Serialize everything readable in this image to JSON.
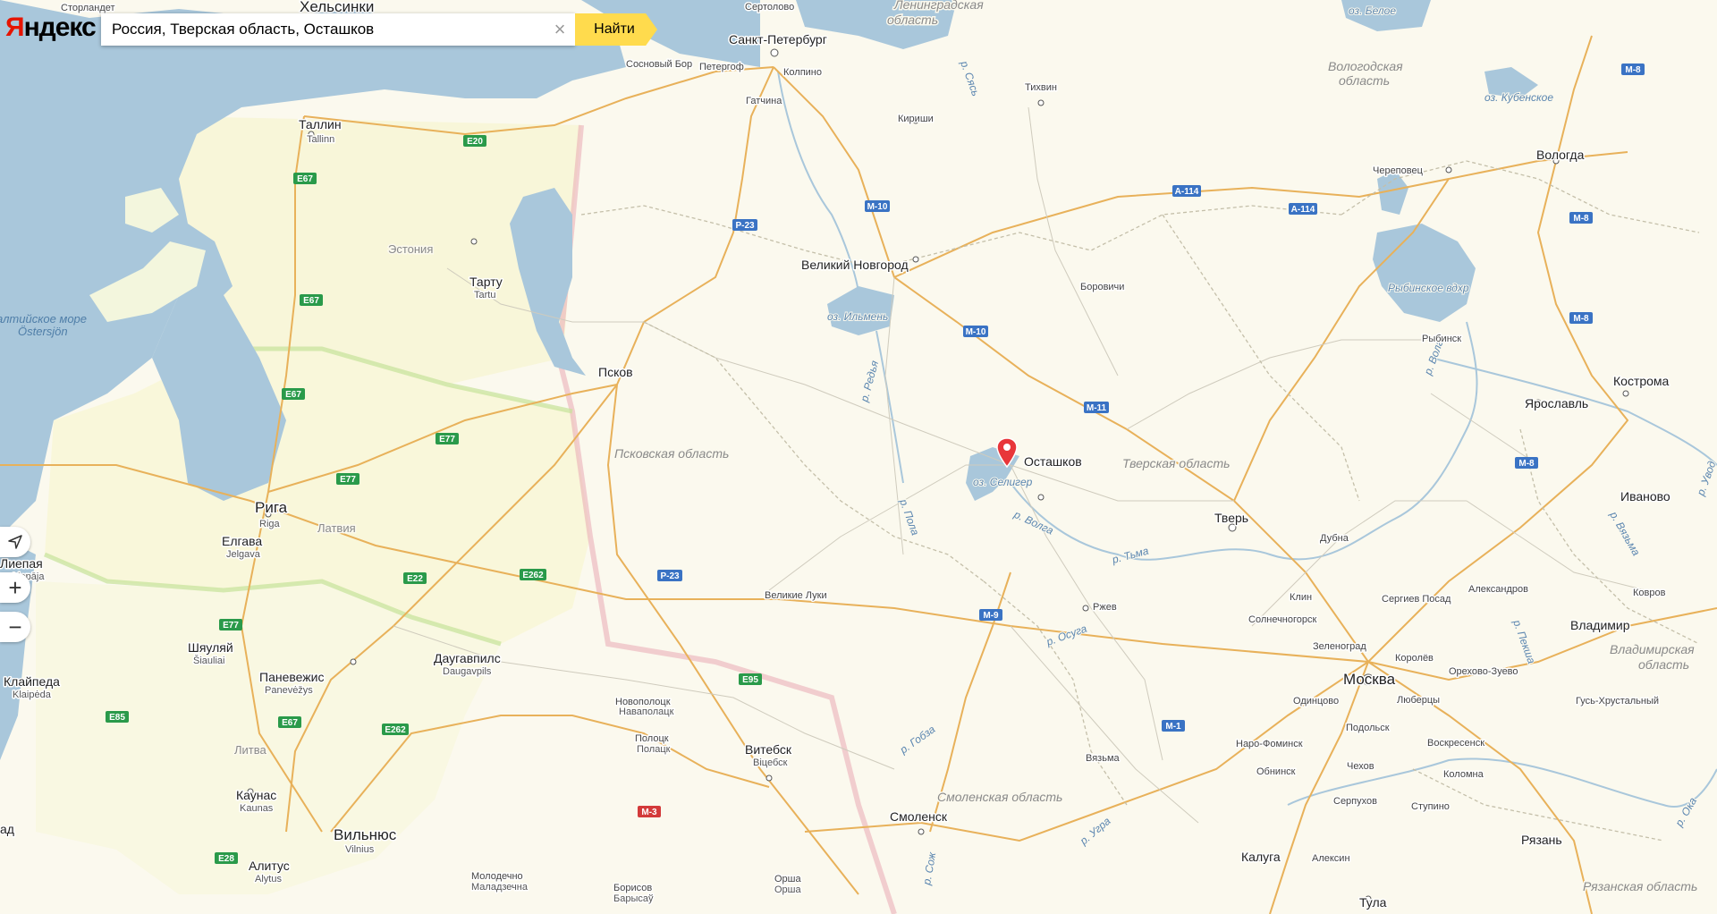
{
  "logo": "Яндекс",
  "search": {
    "value": "Россия, Тверская область, Осташков",
    "button_label": "Найти",
    "clear_icon": "close-icon"
  },
  "controls": {
    "locate_icon": "geolocation-arrow-icon",
    "zoom_in_icon": "plus-icon",
    "zoom_out_icon": "minus-icon"
  },
  "colors": {
    "water": "#a9c7db",
    "land": "#fbf9ee",
    "accent": "#ffdb4d",
    "marker": "#e8363a",
    "logo_red": "#e61400"
  },
  "marker": {
    "label": "Осташков",
    "icon": "location-pin-icon"
  },
  "labels": {
    "cities": {
      "helsinki": "Хельсинки",
      "spb": "Санкт-Петербург",
      "sertolovo": "Сертолово",
      "tallinn": "Таллин",
      "tallinn_local": "Tallinn",
      "tartu": "Тарту",
      "tartu_local": "Tartu",
      "pskov": "Псков",
      "riga": "Рига",
      "riga_local": "Riga",
      "jelgava": "Елгава",
      "jelgava_local": "Jelgava",
      "liepaja": "Лиепая",
      "liepaja_local": "Liepāja",
      "siauliai": "Шяуляй",
      "siauliai_local": "Šiauliai",
      "panevezys": "Паневежис",
      "panevezys_local": "Panevėžys",
      "daugavpils": "Даугавпилс",
      "daugavpils_local": "Daugavpils",
      "klaipeda": "Клайпеда",
      "klaipeda_local": "Klaipėda",
      "kaunas": "Каунас",
      "kaunas_local": "Kaunas",
      "vilnius": "Вильнюс",
      "vilnius_local": "Vilnius",
      "alytus": "Алитус",
      "alytus_local": "Alytus",
      "novgorod": "Великий Новгород",
      "tikhvin": "Тихвин",
      "kirishi": "Кириши",
      "borovichi": "Боровичи",
      "ostashkov": "Осташков",
      "tver": "Тверь",
      "velikie_luki": "Великие Луки",
      "rzhev": "Ржев",
      "vitebsk": "Витебск",
      "vitebsk_local": "Віцебск",
      "novopolotsk": "Новополоцк",
      "novopolotsk_local": "Наваполацк",
      "polotsk": "Полоцк",
      "polotsk_local": "Полацк",
      "smolensk": "Смоленск",
      "moscow": "Москва",
      "vologda": "Вологда",
      "cherepovets": "Череповец",
      "rybinsk": "Рыбинск",
      "yaroslavl": "Ярославль",
      "kostroma": "Кострома",
      "ivanovo": "Иваново",
      "vladimir": "Владимир",
      "sergiev_posad": "Сергиев Посад",
      "aleksandrov": "Александров",
      "dubna": "Дубна",
      "klin": "Клин",
      "solnechnogorsk": "Солнечногорск",
      "zelenograd": "Зеленоград",
      "korolev": "Королёв",
      "orekhovo": "Орехово-Зуево",
      "odintsovo": "Одинцово",
      "lyubertsy": "Люберцы",
      "podolsk": "Подольск",
      "naro_fominsk": "Наро-Фоминск",
      "voskresensk": "Воскресенск",
      "obninsk": "Обнинск",
      "chekhov": "Чехов",
      "kolomna": "Коломна",
      "serpukhov": "Серпухов",
      "stupino": "Ступино",
      "kaluga": "Калуга",
      "aleksin": "Алексин",
      "tula": "Тула",
      "ryazan": "Рязань",
      "gus": "Гусь-Хрустальный",
      "kovrov": "Ковров",
      "vyazma": "Вязьма",
      "gatchina": "Гатчина",
      "kolpino": "Колпино",
      "peterhof": "Петергоф",
      "sosnovy_bor": "Сосновый Бор",
      "orsha": "Орша",
      "orsha_local": "Орша",
      "borisov": "Борисов",
      "borisov_local": "Барысаў",
      "molodechno": "Молодечно",
      "molodechno_local": "Маладзечна",
      "storlandet": "Сторландет",
      "liepaja_partial": "ад"
    },
    "regions": {
      "leningrad": "Ленинградская область",
      "vologda": "Вологодская область",
      "pskov": "Псковская область",
      "tver": "Тверская область",
      "smolensk": "Смоленская область",
      "vladimir": "Владимирская область",
      "ryazan": "Рязанская область"
    },
    "countries": {
      "estonia": "Эстония",
      "latvia": "Латвия",
      "lithuania": "Литва"
    },
    "water": {
      "baltic": "алтийское море",
      "baltic_local": "Östersjön",
      "ilmen": "оз. Ильмень",
      "seliger": "оз. Селигер",
      "beloe": "оз. Белое",
      "kubenskoe": "оз. Кубенское",
      "rybinsk_res": "Рыбинское вдхр",
      "volga": "р. Волга",
      "volga2": "р. Волга",
      "tma": "р. Тьма",
      "osuga": "р. Осуга",
      "gobza": "р. Гобза",
      "ugra": "р. Угра",
      "sozh": "р. Сож",
      "oka": "р. Ока",
      "pola": "р. Пола",
      "redya": "р. Редья",
      "syas": "р. Сясь",
      "peksha": "р. Пекша",
      "vyazma_r": "р. Вязьма",
      "uvod": "р. Увод"
    },
    "roads": {
      "e20": "E20",
      "e67": "E67",
      "e77": "E77",
      "e22": "E22",
      "e262": "E262",
      "e85": "E85",
      "e28": "E28",
      "e95": "E95",
      "m10": "M-10",
      "m11": "M-11",
      "m9": "M-9",
      "m1": "M-1",
      "m8": "M-8",
      "m3": "M-3",
      "p23": "P-23",
      "a114": "A-114"
    }
  }
}
